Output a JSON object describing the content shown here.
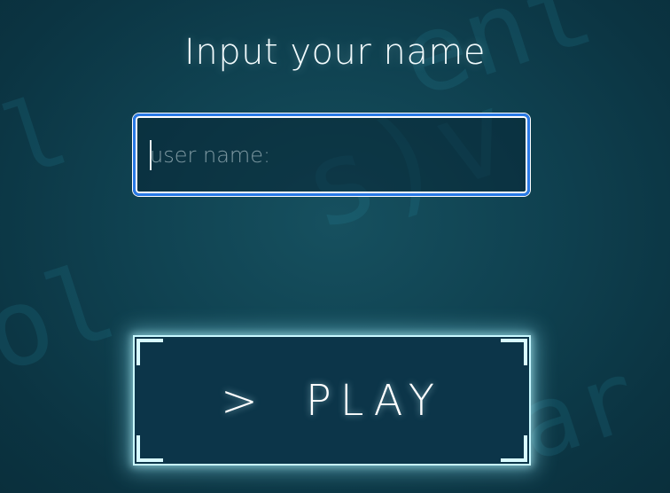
{
  "screen": {
    "title": "Input your name"
  },
  "name_input": {
    "placeholder": "user name:",
    "value": ""
  },
  "play_button": {
    "chevron": ">",
    "label": "PLAY"
  },
  "icons": {
    "play_chevron": "chevron-right-icon"
  },
  "colors": {
    "background": "#0f4150",
    "input_border": "#2979e6",
    "button_glow": "#c8f8ff",
    "button_fill": "#0c3549",
    "text": "#f2fbfd"
  }
}
